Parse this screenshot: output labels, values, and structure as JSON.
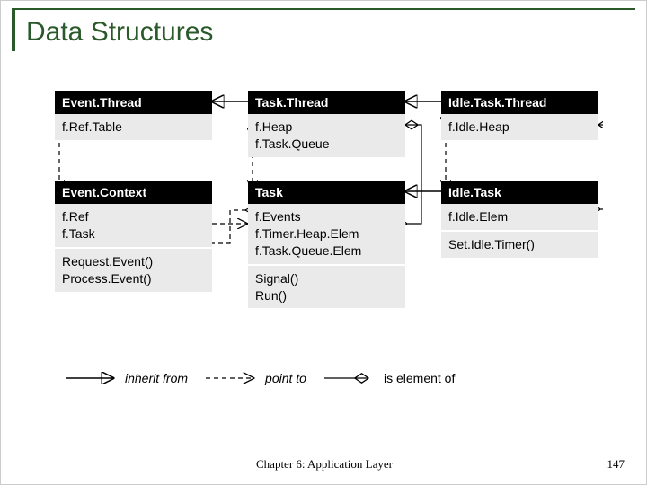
{
  "title": "Data Structures",
  "footer": "Chapter 6: Application Layer",
  "page_number": "147",
  "legend": {
    "inherit": "inherit from",
    "point": "point to",
    "element": "is element of"
  },
  "boxes": {
    "event_thread": {
      "header": "Event.Thread",
      "fields": [
        "f.Ref.Table"
      ]
    },
    "task_thread": {
      "header": "Task.Thread",
      "fields": [
        "f.Heap",
        "f.Task.Queue"
      ]
    },
    "idle_task_thread": {
      "header": "Idle.Task.Thread",
      "fields": [
        "f.Idle.Heap"
      ]
    },
    "event_context": {
      "header": "Event.Context",
      "fields": [
        "f.Ref",
        "f.Task"
      ],
      "methods": [
        "Request.Event()",
        "Process.Event()"
      ]
    },
    "task": {
      "header": "Task",
      "fields": [
        "f.Events",
        "f.Timer.Heap.Elem",
        "f.Task.Queue.Elem"
      ],
      "methods": [
        "Signal()",
        "Run()"
      ]
    },
    "idle_task": {
      "header": "Idle.Task",
      "fields": [
        "f.Idle.Elem"
      ],
      "methods": [
        "Set.Idle.Timer()"
      ]
    }
  }
}
